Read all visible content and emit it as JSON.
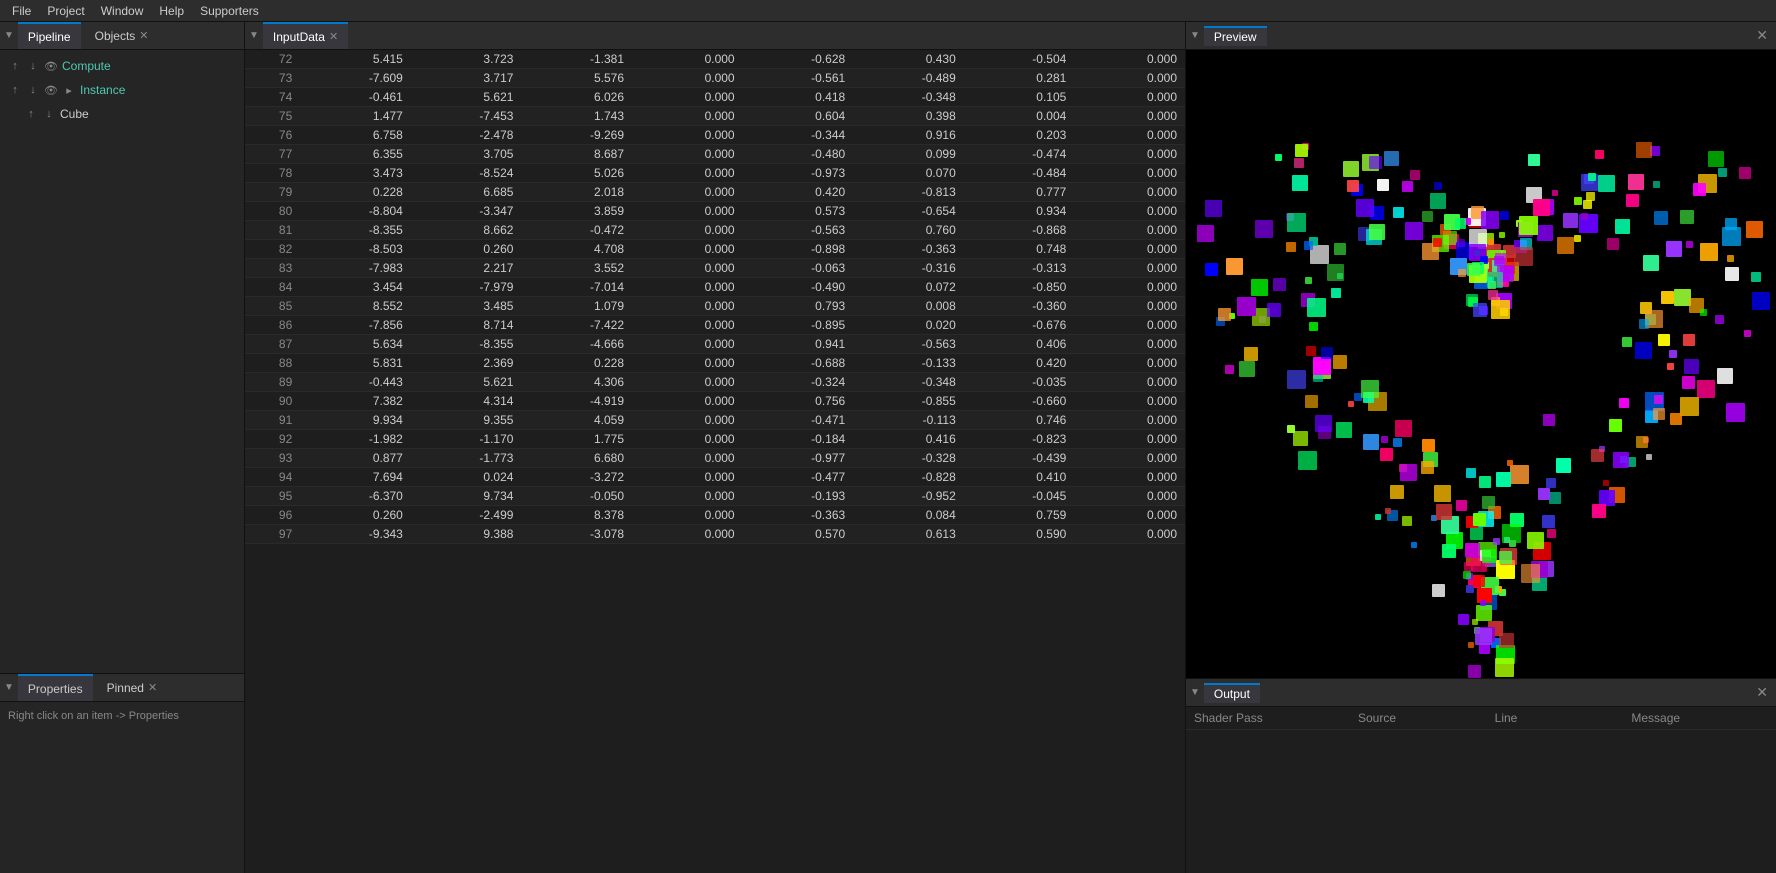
{
  "menubar": {
    "items": [
      "File",
      "Project",
      "Window",
      "Help",
      "Supporters"
    ]
  },
  "pipeline": {
    "tab_label": "Pipeline",
    "objects_tab": "Objects",
    "chevron": "▼",
    "items": [
      {
        "label": "Compute",
        "type": "compute",
        "depth": 0
      },
      {
        "label": "Instance",
        "type": "instance",
        "depth": 0
      },
      {
        "label": "Cube",
        "type": "cube",
        "depth": 1
      }
    ]
  },
  "inputdata": {
    "tab_label": "InputData",
    "rows": [
      [
        72,
        5.415,
        3.723,
        -1.381,
        0.0,
        -0.628,
        0.43,
        -0.504,
        0.0
      ],
      [
        73,
        -7.609,
        3.717,
        5.576,
        0.0,
        -0.561,
        -0.489,
        0.281,
        0.0
      ],
      [
        74,
        -0.461,
        5.621,
        6.026,
        0.0,
        0.418,
        -0.348,
        0.105,
        0.0
      ],
      [
        75,
        1.477,
        -7.453,
        1.743,
        0.0,
        0.604,
        0.398,
        0.004,
        0.0
      ],
      [
        76,
        6.758,
        -2.478,
        -9.269,
        0.0,
        -0.344,
        0.916,
        0.203,
        0.0
      ],
      [
        77,
        6.355,
        3.705,
        8.687,
        0.0,
        -0.48,
        0.099,
        -0.474,
        0.0
      ],
      [
        78,
        3.473,
        -8.524,
        5.026,
        0.0,
        -0.973,
        0.07,
        -0.484,
        0.0
      ],
      [
        79,
        0.228,
        6.685,
        2.018,
        0.0,
        0.42,
        -0.813,
        0.777,
        0.0
      ],
      [
        80,
        -8.804,
        -3.347,
        3.859,
        0.0,
        0.573,
        -0.654,
        0.934,
        0.0
      ],
      [
        81,
        -8.355,
        8.662,
        -0.472,
        0.0,
        -0.563,
        0.76,
        -0.868,
        0.0
      ],
      [
        82,
        -8.503,
        0.26,
        4.708,
        0.0,
        -0.898,
        -0.363,
        0.748,
        0.0
      ],
      [
        83,
        -7.983,
        2.217,
        3.552,
        0.0,
        -0.063,
        -0.316,
        -0.313,
        0.0
      ],
      [
        84,
        3.454,
        -7.979,
        -7.014,
        0.0,
        -0.49,
        0.072,
        -0.85,
        0.0
      ],
      [
        85,
        8.552,
        3.485,
        1.079,
        0.0,
        0.793,
        0.008,
        -0.36,
        0.0
      ],
      [
        86,
        -7.856,
        8.714,
        -7.422,
        0.0,
        -0.895,
        0.02,
        -0.676,
        0.0
      ],
      [
        87,
        5.634,
        -8.355,
        -4.666,
        0.0,
        0.941,
        -0.563,
        0.406,
        0.0
      ],
      [
        88,
        5.831,
        2.369,
        0.228,
        0.0,
        -0.688,
        -0.133,
        0.42,
        0.0
      ],
      [
        89,
        -0.443,
        5.621,
        4.306,
        0.0,
        -0.324,
        -0.348,
        -0.035,
        0.0
      ],
      [
        90,
        7.382,
        4.314,
        -4.919,
        0.0,
        0.756,
        -0.855,
        -0.66,
        0.0
      ],
      [
        91,
        9.934,
        9.355,
        4.059,
        0.0,
        -0.471,
        -0.113,
        0.746,
        0.0
      ],
      [
        92,
        -1.982,
        -1.17,
        1.775,
        0.0,
        -0.184,
        0.416,
        -0.823,
        0.0
      ],
      [
        93,
        0.877,
        -1.773,
        6.68,
        0.0,
        -0.977,
        -0.328,
        -0.439,
        0.0
      ],
      [
        94,
        7.694,
        0.024,
        -3.272,
        0.0,
        -0.477,
        -0.828,
        0.41,
        0.0
      ],
      [
        95,
        -6.37,
        9.734,
        -0.05,
        0.0,
        -0.193,
        -0.952,
        -0.045,
        0.0
      ],
      [
        96,
        0.26,
        -2.499,
        8.378,
        0.0,
        -0.363,
        0.084,
        0.759,
        0.0
      ],
      [
        97,
        -9.343,
        9.388,
        -3.078,
        0.0,
        0.57,
        0.613,
        0.59,
        0.0
      ]
    ]
  },
  "preview": {
    "tab_label": "Preview"
  },
  "properties": {
    "tab_label": "Properties",
    "pinned_tab": "Pinned",
    "hint": "Right click on an item -> Properties"
  },
  "output": {
    "tab_label": "Output",
    "columns": [
      "Shader Pass",
      "Source",
      "Line",
      "Message"
    ]
  },
  "icons": {
    "chevron_down": "▼",
    "arrow_up": "↑",
    "arrow_down": "↓",
    "eye": "👁",
    "collapse": "▸",
    "close": "✕"
  }
}
